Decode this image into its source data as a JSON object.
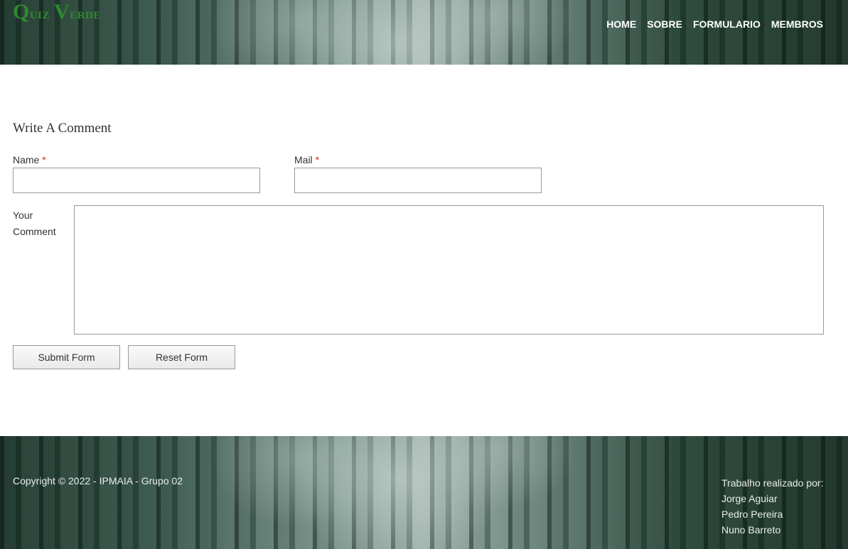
{
  "header": {
    "logo_first_initial": "Q",
    "logo_first_rest": "uiz",
    "logo_second_initial": "V",
    "logo_second_rest": "erde",
    "logo_color": "#2e8b2e",
    "nav": [
      {
        "label": "HOME"
      },
      {
        "label": "SOBRE"
      },
      {
        "label": "FORMULARIO"
      },
      {
        "label": "MEMBROS"
      }
    ]
  },
  "form": {
    "title": "Write A Comment",
    "name_label": "Name",
    "mail_label": "Mail",
    "required_marker": "*",
    "name_value": "",
    "mail_value": "",
    "comment_label_line1": "Your",
    "comment_label_line2": "Comment",
    "comment_value": "",
    "submit_label": "Submit Form",
    "reset_label": "Reset Form",
    "required_color": "#d9232d"
  },
  "footer": {
    "copyright": "Copyright © 2022 - IPMAIA - Grupo 02",
    "credits_title": "Trabalho realizado por:",
    "members": [
      "Jorge Aguiar",
      "Pedro Pereira",
      "Nuno Barreto"
    ]
  }
}
